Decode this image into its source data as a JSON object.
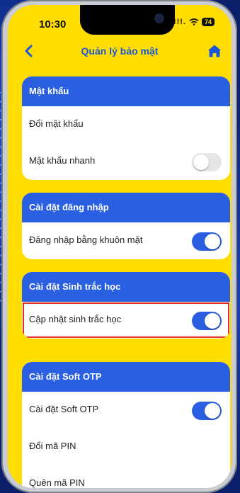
{
  "status_bar": {
    "time": "10:30",
    "signal": "!!!.",
    "battery": "74"
  },
  "nav": {
    "title": "Quản lý bảo mật"
  },
  "sections": [
    {
      "header": "Mật khẩu",
      "rows": [
        {
          "label": "Đổi mật khẩu"
        },
        {
          "label": "Mật khẩu nhanh",
          "toggle": "off"
        }
      ]
    },
    {
      "header": "Cài đặt đăng nhập",
      "rows": [
        {
          "label": "Đăng nhập bằng khuôn mặt",
          "toggle": "on"
        }
      ]
    },
    {
      "header": "Cài đặt Sinh trắc học",
      "rows": [
        {
          "label": "Cập nhật sinh trắc học",
          "toggle": "on"
        }
      ]
    },
    {
      "header": "Cài đặt Soft OTP",
      "rows": [
        {
          "label": "Cài đặt Soft OTP",
          "toggle": "on"
        },
        {
          "label": "Đổi mã PIN"
        },
        {
          "label": "Quên mã PIN"
        }
      ]
    }
  ],
  "colors": {
    "accent": "#2a5fe2",
    "background": "#ffdd00",
    "highlight": "#e03030"
  }
}
